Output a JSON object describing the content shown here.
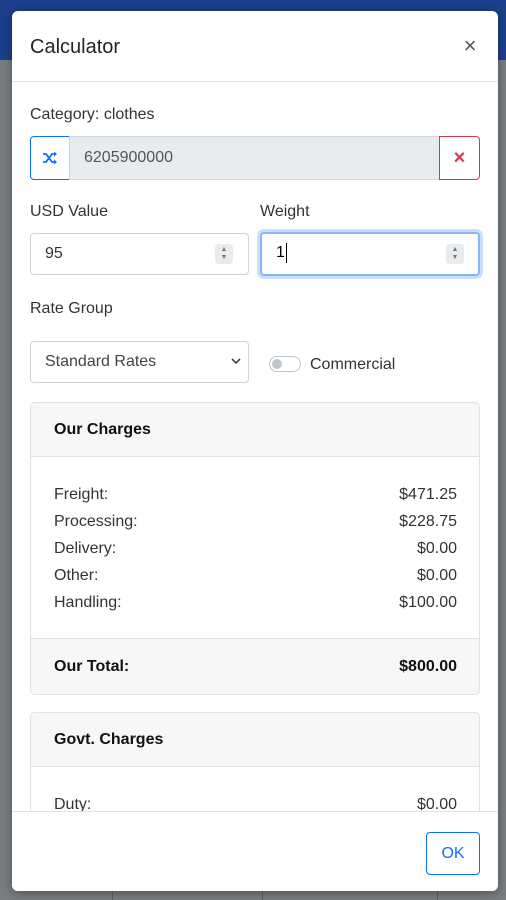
{
  "modal": {
    "title": "Calculator",
    "close_symbol": "×"
  },
  "category": {
    "label": "Category: clothes",
    "code_value": "6205900000",
    "randomize_icon": "shuffle-icon",
    "clear_symbol": "×"
  },
  "usd_value": {
    "label": "USD Value",
    "value": "95"
  },
  "weight": {
    "label": "Weight",
    "value": "1"
  },
  "rate_group": {
    "label": "Rate Group",
    "selected": "Standard Rates",
    "chevron_symbol": "⌄"
  },
  "commercial": {
    "label": "Commercial",
    "checked": false
  },
  "our_charges": {
    "header": "Our Charges",
    "rows": [
      {
        "label": "Freight:",
        "value": "$471.25"
      },
      {
        "label": "Processing:",
        "value": "$228.75"
      },
      {
        "label": "Delivery:",
        "value": "$0.00"
      },
      {
        "label": "Other:",
        "value": "$0.00"
      },
      {
        "label": "Handling:",
        "value": "$100.00"
      }
    ],
    "total_label": "Our Total:",
    "total_value": "$800.00"
  },
  "govt_charges": {
    "header": "Govt. Charges",
    "rows": [
      {
        "label": "Duty:",
        "value": "$0.00"
      }
    ]
  },
  "footer": {
    "ok_label": "OK"
  },
  "colors": {
    "primary": "#0d6efd",
    "danger": "#dc3545",
    "header_band": "#1c3f8a"
  }
}
